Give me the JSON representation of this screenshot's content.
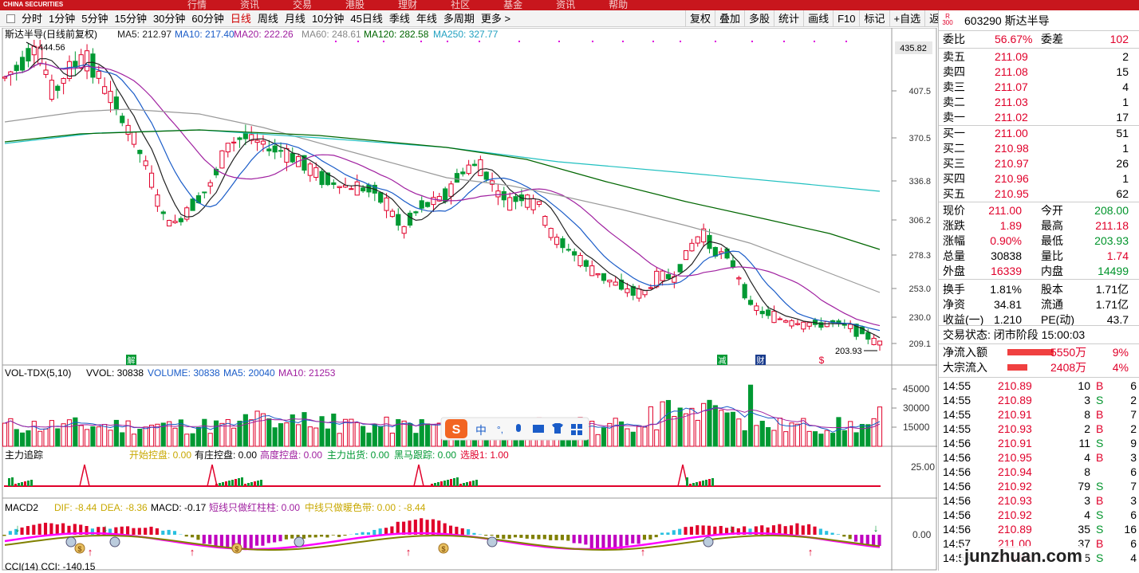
{
  "app": {
    "logo": "CHINA SECURITIES",
    "menu": [
      "行情",
      "资讯",
      "交易",
      "港股",
      "理财",
      "社区",
      "基金",
      "资讯",
      "帮助"
    ]
  },
  "periods": [
    "分时",
    "1分钟",
    "5分钟",
    "15分钟",
    "30分钟",
    "60分钟",
    "日线",
    "周线",
    "月线",
    "10分钟",
    "45日线",
    "季线",
    "年线",
    "多周期",
    "更多 >"
  ],
  "active_period": "日线",
  "tools": [
    "复权",
    "叠加",
    "多股",
    "统计",
    "画线",
    "F10",
    "标记",
    "+自选",
    "返回"
  ],
  "chart_header": {
    "name": "斯达半导(日线前复权)",
    "ma5": "MA5: 212.97",
    "ma10": "MA10: 217.40",
    "ma20": "MA20: 222.26",
    "ma60": "MA60: 248.61",
    "ma120": "MA120: 282.58",
    "ma250": "MA250: 327.77"
  },
  "price_axis": {
    "top": "435.82",
    "ticks": [
      "407.5",
      "370.5",
      "336.8",
      "306.2",
      "278.3",
      "253.0",
      "230.0",
      "209.1"
    ],
    "high_mark": "444.56",
    "low_mark": "203.93"
  },
  "vol_header": {
    "t": "VOL-TDX(5,10)",
    "vvol": "VVOL: 30838",
    "volume": "VOLUME: 30838",
    "ma5": "MA5: 20040",
    "ma10": "MA10: 21253"
  },
  "vol_axis": [
    "45000",
    "30000",
    "15000"
  ],
  "zl_header": {
    "t": "主力追踪",
    "a": "开始控盘: 0.00",
    "b": "有庄控盘: 0.00",
    "c": "高度控盘: 0.00",
    "d": "主力出货: 0.00",
    "e": "黑马跟踪: 0.00",
    "f": "选股1: 1.00"
  },
  "zl_axis": "25.00",
  "macd_header": {
    "t": "MACD2",
    "dif": "DIF: -8.44",
    "dea": "DEA: -8.36",
    "macd": "MACD: -0.17",
    "a": "短线只做红柱柱: 0.00",
    "b": "中线只做暖色带: 0.00 : -8.44"
  },
  "macd_axis": "0.00",
  "cci_header": "CCI(14)  CCI: -140.15",
  "markers": {
    "jie": "解",
    "jian": "减",
    "cai": "财",
    "s": "$"
  },
  "ime": {
    "logo": "S",
    "cn": "中",
    "punct": "°,"
  },
  "stock": {
    "code": "603290",
    "name": "斯达半导",
    "badge": "R 300"
  },
  "weibi": {
    "l": "委比",
    "v": "56.67%",
    "l2": "委差",
    "v2": "102"
  },
  "asks": [
    {
      "l": "卖五",
      "p": "211.09",
      "q": "2"
    },
    {
      "l": "卖四",
      "p": "211.08",
      "q": "15"
    },
    {
      "l": "卖三",
      "p": "211.07",
      "q": "4"
    },
    {
      "l": "卖二",
      "p": "211.03",
      "q": "1"
    },
    {
      "l": "卖一",
      "p": "211.02",
      "q": "17"
    }
  ],
  "bids": [
    {
      "l": "买一",
      "p": "211.00",
      "q": "51"
    },
    {
      "l": "买二",
      "p": "210.98",
      "q": "1"
    },
    {
      "l": "买三",
      "p": "210.97",
      "q": "26"
    },
    {
      "l": "买四",
      "p": "210.96",
      "q": "1"
    },
    {
      "l": "买五",
      "p": "210.95",
      "q": "62"
    }
  ],
  "quote": [
    {
      "l": "现价",
      "v": "211.00",
      "vc": "red",
      "l2": "今开",
      "v2": "208.00",
      "v2c": "grn"
    },
    {
      "l": "涨跌",
      "v": "1.89",
      "vc": "red",
      "l2": "最高",
      "v2": "211.18",
      "v2c": "red"
    },
    {
      "l": "涨幅",
      "v": "0.90%",
      "vc": "red",
      "l2": "最低",
      "v2": "203.93",
      "v2c": "grn"
    },
    {
      "l": "总量",
      "v": "30838",
      "vc": "",
      "l2": "量比",
      "v2": "1.74",
      "v2c": "red"
    },
    {
      "l": "外盘",
      "v": "16339",
      "vc": "red",
      "l2": "内盘",
      "v2": "14499",
      "v2c": "grn"
    },
    {
      "l": "换手",
      "v": "1.81%",
      "vc": "",
      "l2": "股本",
      "v2": "1.71亿",
      "v2c": ""
    },
    {
      "l": "净资",
      "v": "34.81",
      "vc": "",
      "l2": "流通",
      "v2": "1.71亿",
      "v2c": ""
    },
    {
      "l": "收益(一)",
      "v": "1.210",
      "vc": "",
      "l2": "PE(动)",
      "v2": "43.7",
      "v2c": ""
    }
  ],
  "status": "交易状态: 闭市阶段 15:00:03",
  "flow": [
    {
      "l": "净流入额",
      "v": "5550万",
      "p": "9%",
      "w": 0.55
    },
    {
      "l": "大宗流入",
      "v": "2408万",
      "p": "4%",
      "w": 0.24
    }
  ],
  "ticks": [
    {
      "t": "14:55",
      "p": "210.89",
      "v": "10",
      "d": "B",
      "n": "6"
    },
    {
      "t": "14:55",
      "p": "210.89",
      "v": "3",
      "d": "S",
      "n": "2"
    },
    {
      "t": "14:55",
      "p": "210.91",
      "v": "8",
      "d": "B",
      "n": "7"
    },
    {
      "t": "14:55",
      "p": "210.93",
      "v": "2",
      "d": "B",
      "n": "2"
    },
    {
      "t": "14:56",
      "p": "210.91",
      "v": "11",
      "d": "S",
      "n": "9"
    },
    {
      "t": "14:56",
      "p": "210.95",
      "v": "4",
      "d": "B",
      "n": "3"
    },
    {
      "t": "14:56",
      "p": "210.94",
      "v": "8",
      "d": "",
      "n": "6"
    },
    {
      "t": "14:56",
      "p": "210.92",
      "v": "79",
      "d": "S",
      "n": "7"
    },
    {
      "t": "14:56",
      "p": "210.93",
      "v": "3",
      "d": "B",
      "n": "3"
    },
    {
      "t": "14:56",
      "p": "210.92",
      "v": "4",
      "d": "S",
      "n": "6"
    },
    {
      "t": "14:56",
      "p": "210.89",
      "v": "35",
      "d": "S",
      "n": "16"
    },
    {
      "t": "14:57",
      "p": "211.00",
      "v": "37",
      "d": "B",
      "n": "6"
    },
    {
      "t": "14:56",
      "p": "210.92",
      "v": "5",
      "d": "S",
      "n": "4"
    }
  ],
  "watermark": "junzhuan.com"
}
